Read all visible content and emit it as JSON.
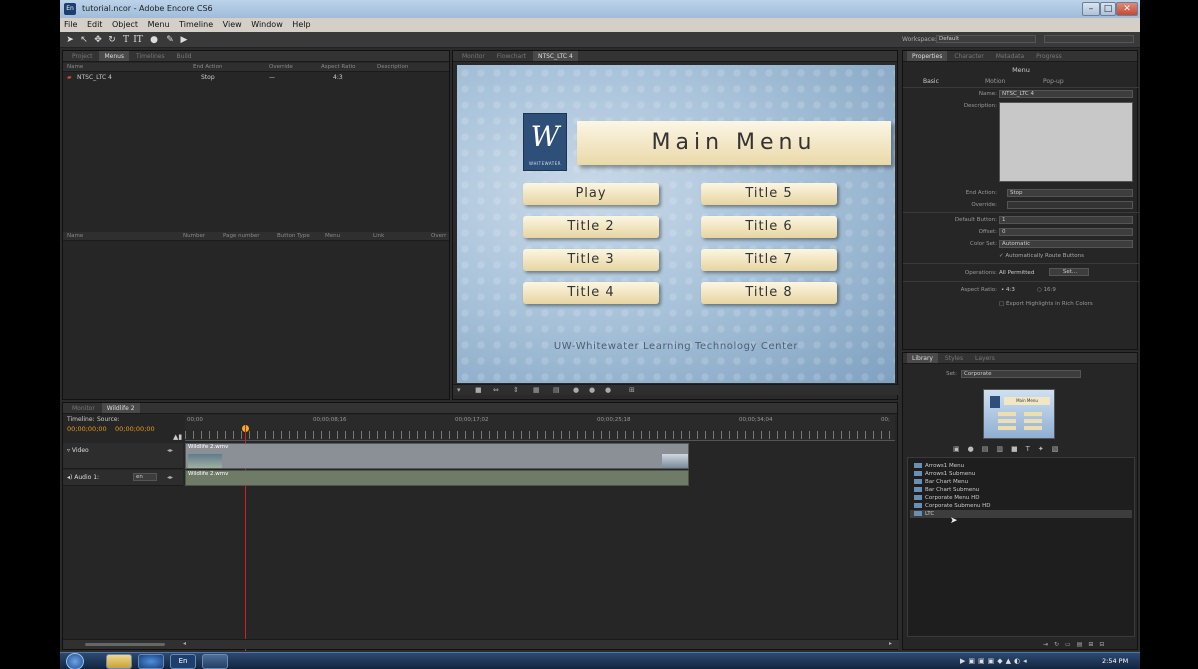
{
  "window": {
    "title": "tutorial.ncor - Adobe Encore CS6",
    "app_icon": "En"
  },
  "menubar": [
    "File",
    "Edit",
    "Object",
    "Menu",
    "Timeline",
    "View",
    "Window",
    "Help"
  ],
  "toolbar": {
    "workspace_label": "Workspace:",
    "workspace_value": "Default"
  },
  "project_panel": {
    "tabs": [
      "Project",
      "Menus",
      "Timelines",
      "Build"
    ],
    "active_tab": "Menus",
    "columns": [
      "Name",
      "End Action",
      "Override",
      "Aspect Ratio",
      "Description"
    ],
    "rows": [
      {
        "name": "NTSC_LTC 4",
        "end_action": "Stop",
        "override": "—",
        "aspect": "4:3"
      }
    ],
    "button_columns": [
      "Name",
      "Number",
      "Page number",
      "Button Type",
      "Menu",
      "Link",
      "Overr"
    ]
  },
  "monitor": {
    "tabs": [
      "Monitor",
      "Flowchart",
      "NTSC_LTC 4"
    ],
    "menu_title": "Main Menu",
    "logo_letter": "W",
    "logo_text": "WHITEWATER",
    "buttons": [
      "Play",
      "Title 2",
      "Title 3",
      "Title 4",
      "Title 5",
      "Title 6",
      "Title 7",
      "Title 8"
    ],
    "footer": "UW-Whitewater Learning Technology Center"
  },
  "timeline": {
    "tabs": [
      "Monitor",
      "Wildlife 2"
    ],
    "timeline_label": "Timeline:",
    "source_label": "Source:",
    "timecode_a": "00;00;00;00",
    "timecode_b": "00;00;00;00",
    "ticks": [
      "00;00",
      "00;00;08;16",
      "00;00;17;02",
      "00;00;25;18",
      "00;00;34;04",
      "00;"
    ],
    "video_track": "Video",
    "audio_track": "Audio 1:",
    "audio_lang": "en",
    "video_clip": "Wildlife 2.wmv",
    "audio_clip": "Wildlife 2.wmv"
  },
  "properties": {
    "tabs": [
      "Properties",
      "Character",
      "Metadata",
      "Progress"
    ],
    "header": "Menu",
    "subtabs": [
      "Basic",
      "Motion",
      "Pop-up"
    ],
    "name_label": "Name:",
    "name_value": "NTSC_LTC 4",
    "description_label": "Description:",
    "end_action_label": "End Action:",
    "end_action_value": "Stop",
    "override_label": "Override:",
    "default_button_label": "Default Button:",
    "default_button_value": "1",
    "offset_label": "Offset:",
    "offset_value": "0",
    "color_set_label": "Color Set:",
    "color_set_value": "Automatic",
    "auto_route": "Automatically Route Buttons",
    "operations_label": "Operations:",
    "operations_value": "All Permitted",
    "operations_btn": "Set...",
    "aspect_label": "Aspect Ratio:",
    "aspect_43": "4:3",
    "aspect_169": "16:9",
    "export_rich": "Export Highlights in Rich Colors"
  },
  "library": {
    "tabs": [
      "Library",
      "Styles",
      "Layers"
    ],
    "set_label": "Set:",
    "set_value": "Corporate",
    "thumb_title": "Main Menu",
    "items": [
      "Arrows1 Menu",
      "Arrows1 Submenu",
      "Bar Chart Menu",
      "Bar Chart Submenu",
      "Corporate Menu HD",
      "Corporate Submenu HD",
      "LTC"
    ],
    "selected": "LTC"
  },
  "taskbar": {
    "time": "2:54 PM",
    "en_label": "En"
  },
  "colors": {
    "accent_orange": "#e89b1e",
    "playhead": "#d21f1f",
    "menu_bg": "#a9c3da"
  }
}
